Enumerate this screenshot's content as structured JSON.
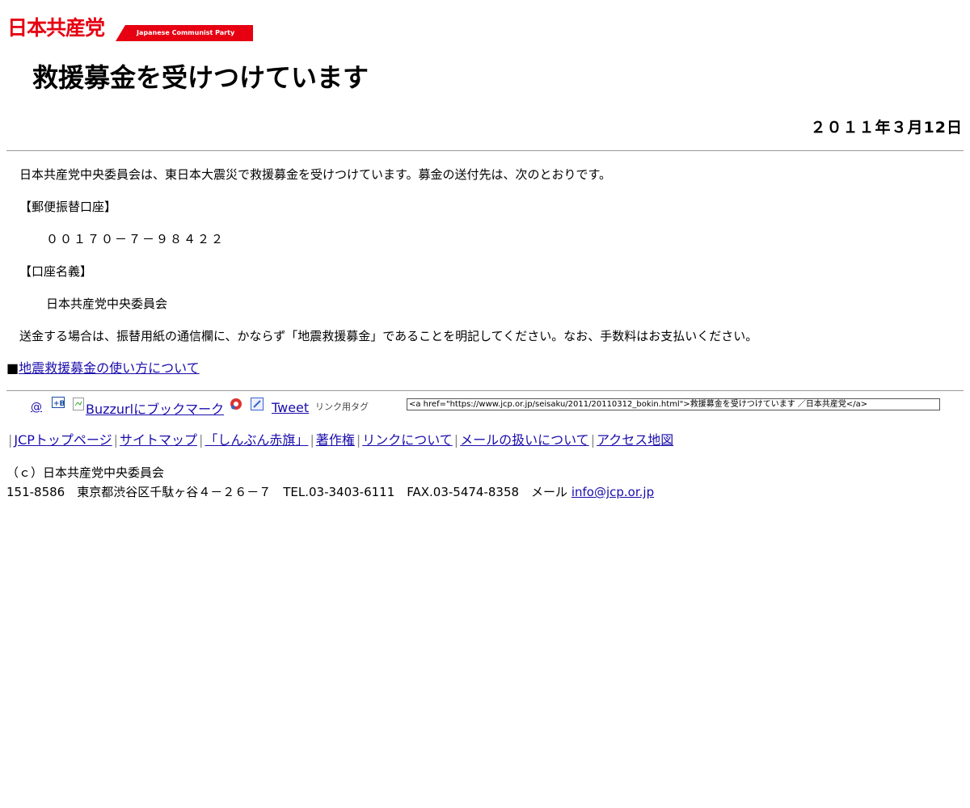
{
  "header": {
    "logo_jp": "日本共産党",
    "logo_en": "Japanese Communist Party",
    "brand_color": "#e60012"
  },
  "article": {
    "title": "救援募金を受けつけています",
    "date": "２０１１年３月12日",
    "intro": "日本共産党中央委員会は、東日本大震災で救援募金を受けつけています。募金の送付先は、次のとおりです。",
    "account_heading": "【郵便振替口座】",
    "account_number": "００１７０－７－９８４２２",
    "name_heading": "【口座名義】",
    "account_name": "日本共産党中央委員会",
    "note": "送金する場合は、振替用紙の通信欄に、かならず「地震救援募金」であることを明記してください。なお、手数料はお支払いください。",
    "related_bullet": "■",
    "related_link": "地震救援募金の使い方について"
  },
  "share": {
    "at_icon": "at-icon",
    "hatena_icon": "hatena-bookmark-icon",
    "buzzurl_label": "Buzzurlにブックマーク",
    "delicious_icon": "bookmark-icon",
    "pen_icon": "pencil-icon",
    "tweet_label": "Tweet",
    "link_tag_label": "リンク用タグ",
    "link_tag_value": "<a href=\"https://www.jcp.or.jp/seisaku/2011/20110312_bokin.html\">救援募金を受けつけています ／日本共産党</a>"
  },
  "nav": {
    "items": [
      "JCPトップページ",
      "サイトマップ",
      "「しんぶん赤旗」",
      "著作権",
      "リンクについて",
      "メールの扱いについて",
      "アクセス地図"
    ]
  },
  "footer": {
    "copyright": "（ｃ）日本共産党中央委員会",
    "address": "151-8586　東京都渋谷区千駄ヶ谷４－２６－７　TEL.03-3403-6111　FAX.03-5474-8358　メール ",
    "email": "info@jcp.or.jp"
  }
}
